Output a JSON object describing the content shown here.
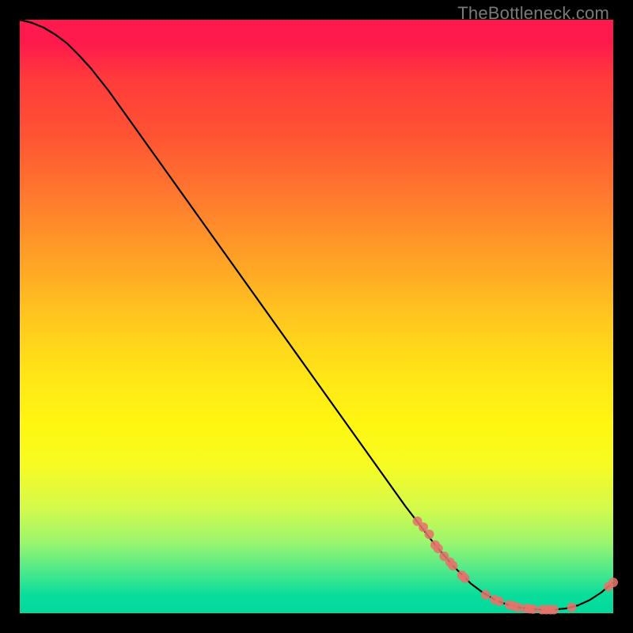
{
  "watermark": "TheBottleneck.com",
  "chart_data": {
    "type": "line",
    "title": "",
    "xlabel": "",
    "ylabel": "",
    "xlim": [
      0,
      100
    ],
    "ylim": [
      0,
      100
    ],
    "grid": false,
    "legend": false,
    "background_gradient": {
      "top": "#ff1a4d",
      "mid": "#ffe617",
      "bottom": "#03d99e"
    },
    "series": [
      {
        "name": "curve",
        "color": "#000000",
        "x": [
          0,
          2,
          4,
          6,
          8,
          10,
          12,
          15,
          20,
          25,
          30,
          35,
          40,
          45,
          50,
          55,
          60,
          65,
          70,
          73,
          76,
          78,
          80,
          82,
          84,
          86,
          88,
          90,
          92,
          94,
          96,
          98,
          100
        ],
        "y": [
          100,
          99.5,
          98.7,
          97.5,
          96.0,
          94.0,
          91.8,
          88.0,
          81.0,
          74.0,
          67.0,
          60.0,
          53.0,
          46.0,
          39.0,
          32.0,
          25.0,
          18.0,
          11.5,
          8.0,
          5.0,
          3.5,
          2.3,
          1.5,
          1.0,
          0.7,
          0.6,
          0.6,
          0.8,
          1.3,
          2.2,
          3.5,
          5.2
        ]
      }
    ],
    "markers": {
      "color": "#e4746b",
      "radius": 6,
      "points": [
        {
          "x": 67,
          "y": 15.5
        },
        {
          "x": 68,
          "y": 14.5
        },
        {
          "x": 69,
          "y": 13.3
        },
        {
          "x": 70,
          "y": 11.5
        },
        {
          "x": 70.5,
          "y": 10.9
        },
        {
          "x": 71.5,
          "y": 9.6
        },
        {
          "x": 72.5,
          "y": 8.6
        },
        {
          "x": 73,
          "y": 8.0
        },
        {
          "x": 74.5,
          "y": 6.4
        },
        {
          "x": 75,
          "y": 5.9
        },
        {
          "x": 78.5,
          "y": 3.1
        },
        {
          "x": 80,
          "y": 2.3
        },
        {
          "x": 80.8,
          "y": 2.0
        },
        {
          "x": 82.5,
          "y": 1.4
        },
        {
          "x": 83.2,
          "y": 1.2
        },
        {
          "x": 84,
          "y": 1.0
        },
        {
          "x": 85.3,
          "y": 0.8
        },
        {
          "x": 85.9,
          "y": 0.75
        },
        {
          "x": 86.5,
          "y": 0.7
        },
        {
          "x": 88,
          "y": 0.6
        },
        {
          "x": 88.7,
          "y": 0.6
        },
        {
          "x": 89.4,
          "y": 0.6
        },
        {
          "x": 90,
          "y": 0.6
        },
        {
          "x": 93,
          "y": 1.0
        },
        {
          "x": 99.2,
          "y": 4.5
        },
        {
          "x": 100,
          "y": 5.2
        }
      ]
    }
  }
}
